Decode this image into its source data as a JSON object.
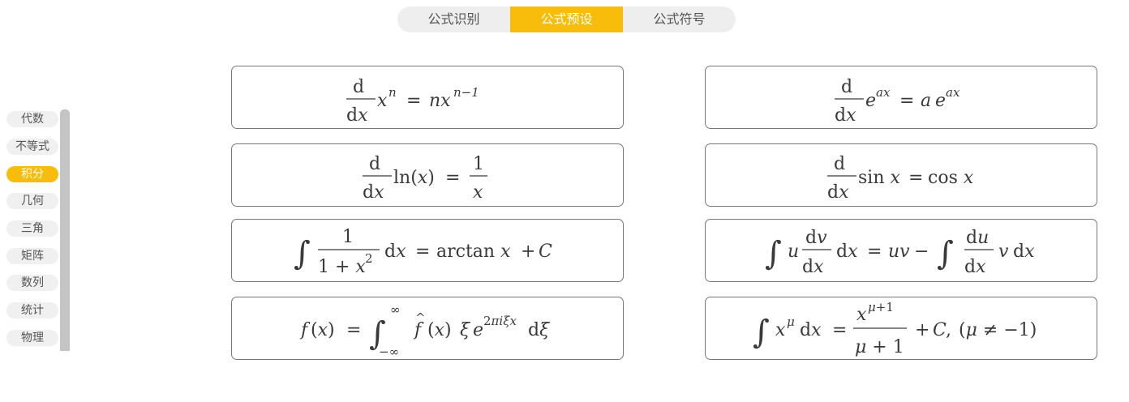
{
  "tabs": [
    {
      "label": "公式识别",
      "active": false
    },
    {
      "label": "公式预设",
      "active": true
    },
    {
      "label": "公式符号",
      "active": false
    }
  ],
  "categories": [
    {
      "label": "代数",
      "active": false
    },
    {
      "label": "不等式",
      "active": false
    },
    {
      "label": "积分",
      "active": true
    },
    {
      "label": "几何",
      "active": false
    },
    {
      "label": "三角",
      "active": false
    },
    {
      "label": "矩阵",
      "active": false
    },
    {
      "label": "数列",
      "active": false
    },
    {
      "label": "统计",
      "active": false
    },
    {
      "label": "物理",
      "active": false
    }
  ],
  "formulas": [
    {
      "id": "deriv-power",
      "latex": "\\frac{d}{dx}x^n = nx^{n-1}"
    },
    {
      "id": "deriv-exp",
      "latex": "\\frac{d}{dx}e^{ax} = a\\,e^{ax}"
    },
    {
      "id": "deriv-log",
      "latex": "\\frac{d}{dx}\\ln(x) = \\frac{1}{x}"
    },
    {
      "id": "deriv-sin",
      "latex": "\\frac{d}{dx}\\sin x = \\cos x"
    },
    {
      "id": "integral-arctan",
      "latex": "\\int \\frac{1}{1+x^2}dx = \\arctan x + C"
    },
    {
      "id": "integral-by-parts",
      "latex": "\\int u\\frac{dv}{dx}dx = uv - \\int \\frac{du}{dx}v\\,dx"
    },
    {
      "id": "fourier-transform",
      "latex": "f(x) = \\int_{-\\infty}^{\\infty}\\hat{f}(x)\\xi\\,e^{2\\pi i\\xi x}\\,d\\xi"
    },
    {
      "id": "integral-power",
      "latex": "\\int x^\\mu dx = \\frac{x^{\\mu+1}}{\\mu+1} + C, (\\mu \\neq -1)"
    }
  ],
  "colors": {
    "accent": "#f7bd0a",
    "tab_bg": "#eeeeee",
    "card_border": "#777777"
  }
}
